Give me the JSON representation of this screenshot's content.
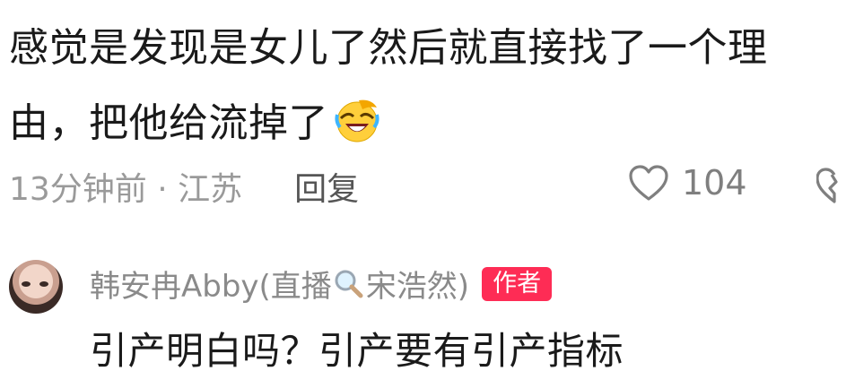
{
  "comment": {
    "line1": "感觉是发现是女儿了然后就直接找了一个理",
    "line2": "由，把他给流掉了",
    "emoji": "rofl-emoji"
  },
  "meta": {
    "time_location": "13分钟前 · 江苏",
    "reply_label": "回复",
    "like_count": "104",
    "like_icon": "heart-outline-icon",
    "dislike_icon": "broken-heart-icon"
  },
  "reply": {
    "author_name_part1": "韩安冉Abby(直播",
    "author_name_part2": "宋浩然)",
    "author_icon": "magnifier-emoji",
    "author_badge": "作者",
    "text": "引产明白吗？引产要有引产指标",
    "colors": {
      "badge": "#fe2c55"
    }
  }
}
